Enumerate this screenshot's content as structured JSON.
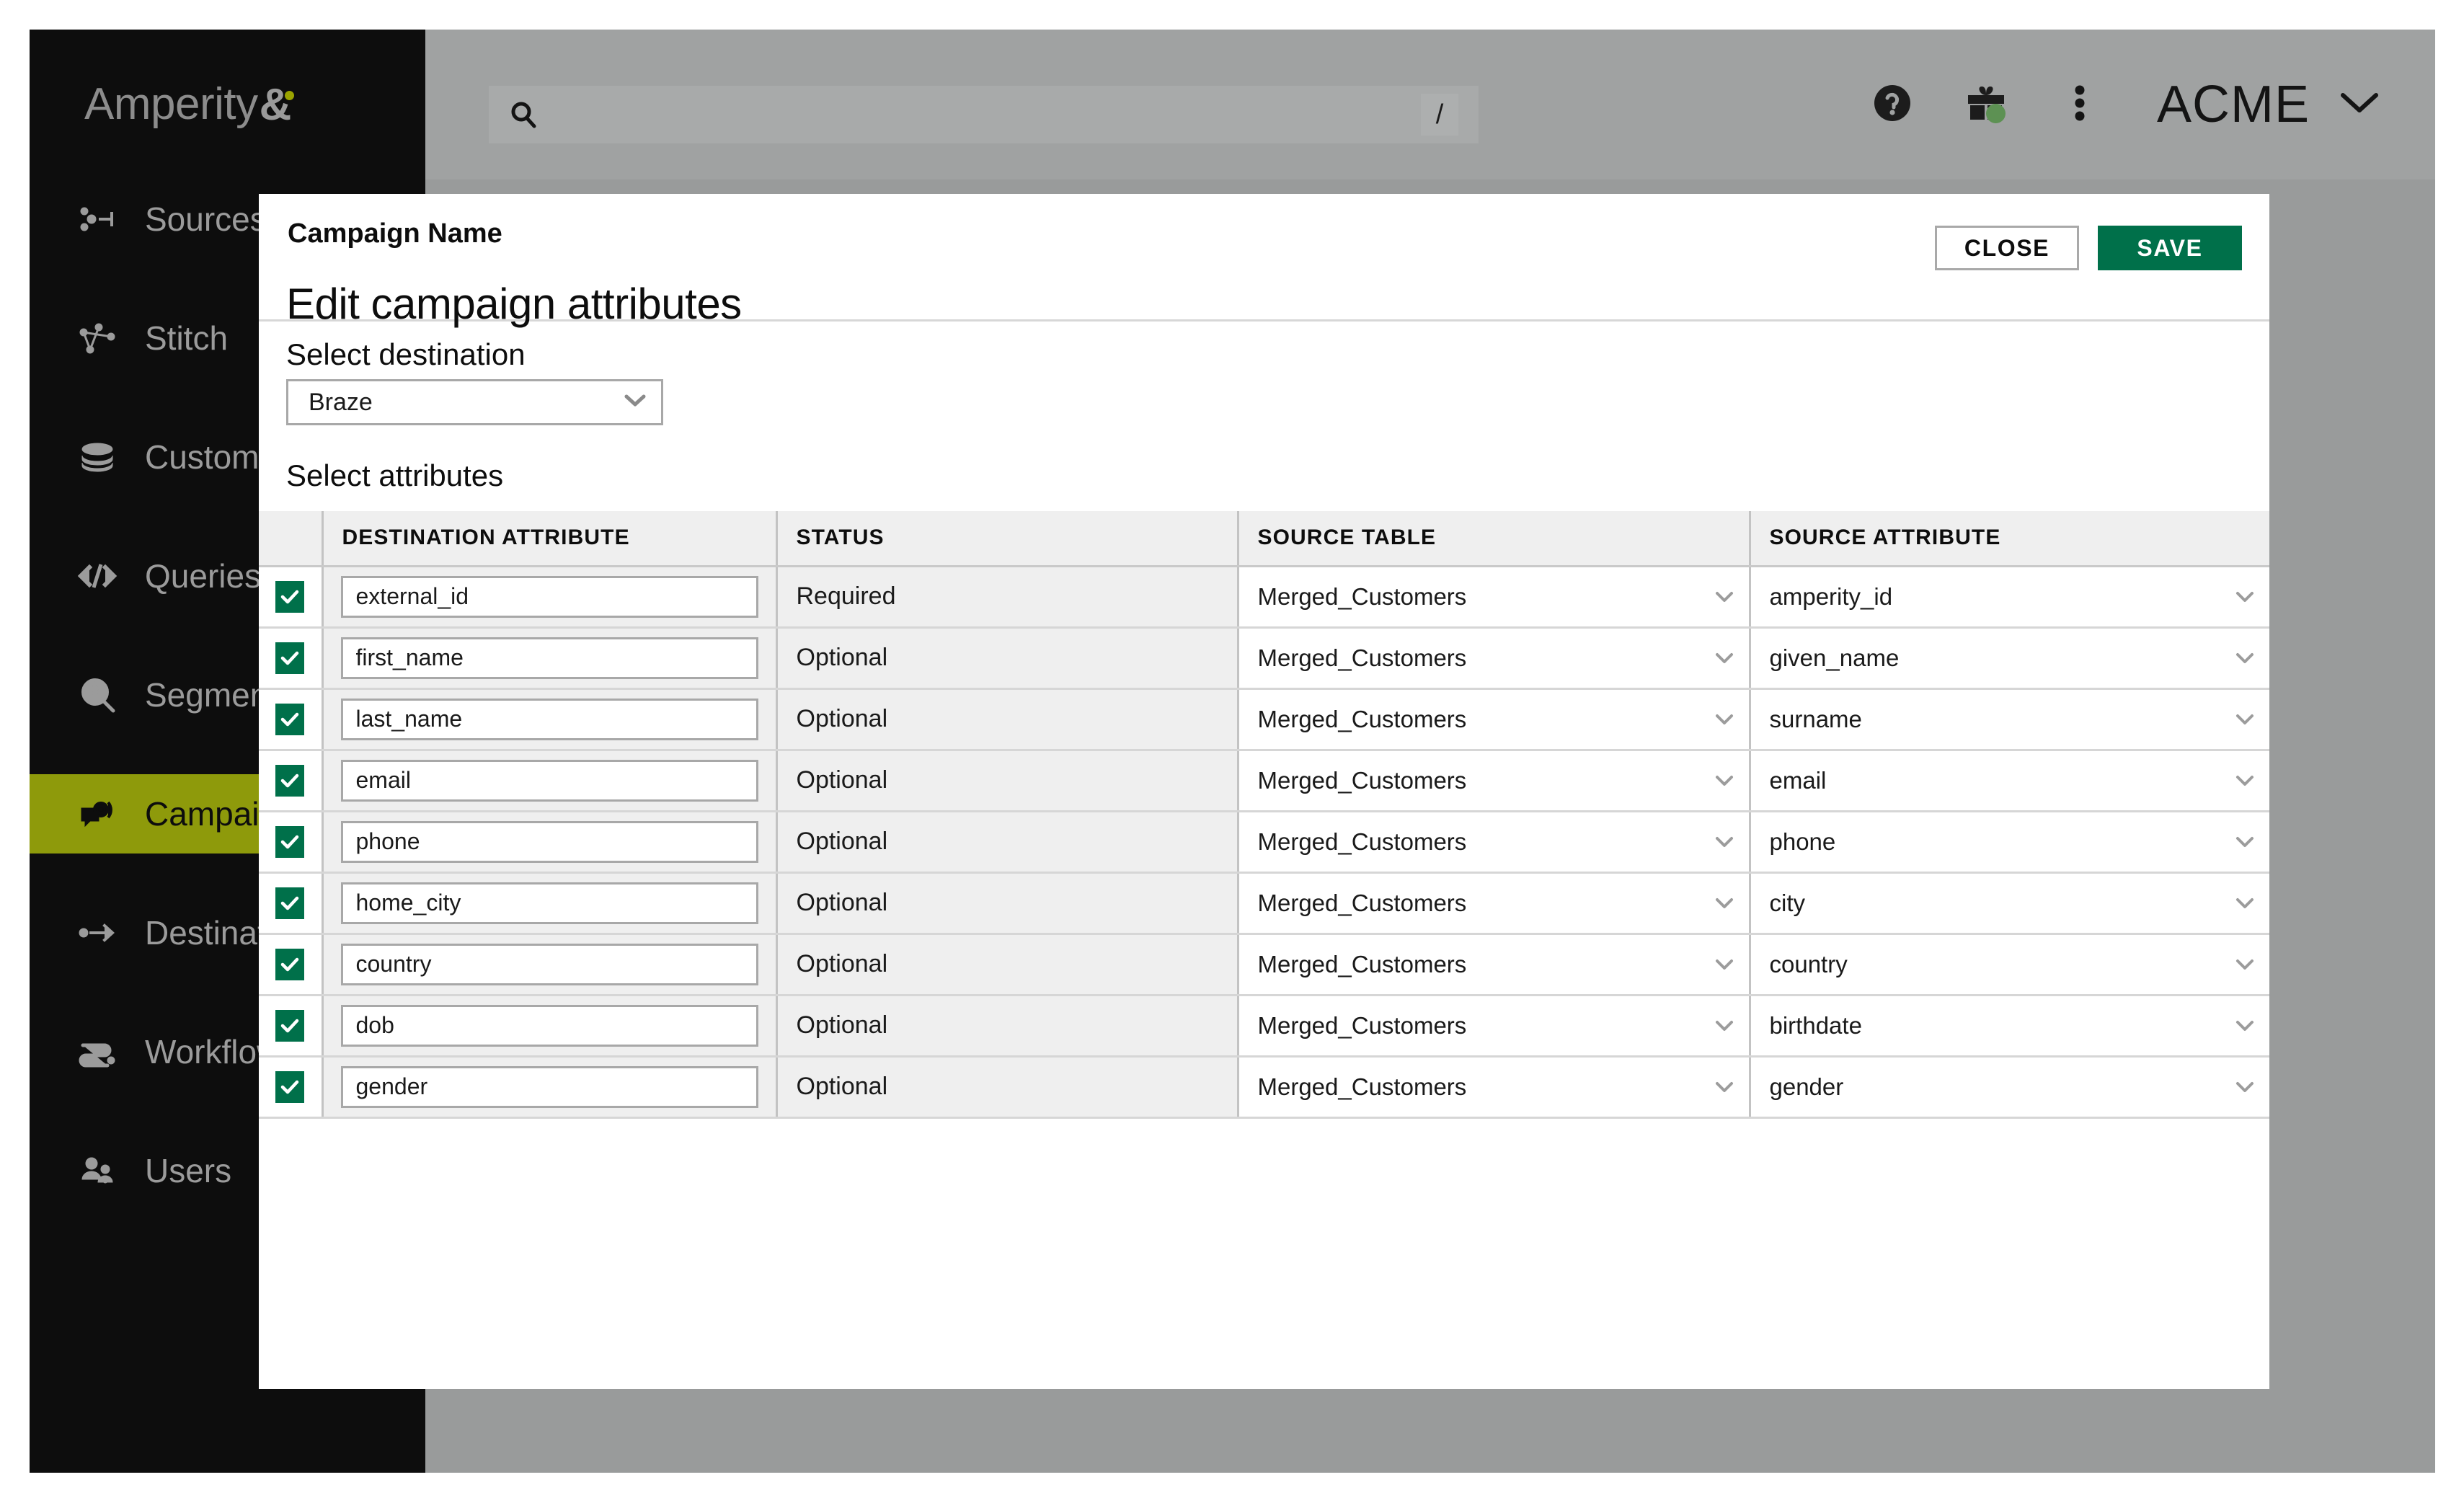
{
  "app": {
    "brand": {
      "name": "Amperity",
      "ampersand": "&"
    }
  },
  "topbar": {
    "search": {
      "placeholder": "",
      "value": "",
      "shortcut": "/",
      "icon": "search-icon"
    },
    "help_icon": "help-circle-icon",
    "gift_icon": "gift-icon",
    "gift_badge": true,
    "more_icon": "kebab-menu-icon",
    "account": {
      "name": "ACME",
      "chevron": "chevron-down-icon"
    }
  },
  "sidebar": {
    "items": [
      {
        "label": "Sources",
        "icon": "sources-icon",
        "active": false
      },
      {
        "label": "Stitch",
        "icon": "stitch-icon",
        "active": false
      },
      {
        "label": "Customers",
        "icon": "customers-icon",
        "active": false
      },
      {
        "label": "Queries",
        "icon": "queries-icon",
        "active": false
      },
      {
        "label": "Segments",
        "icon": "segments-icon",
        "active": false
      },
      {
        "label": "Campaigns",
        "icon": "campaigns-icon",
        "active": true
      },
      {
        "label": "Destinations",
        "icon": "destinations-icon",
        "active": false
      },
      {
        "label": "Workflows",
        "icon": "workflows-icon",
        "active": false
      },
      {
        "label": "Users",
        "icon": "users-icon",
        "active": false
      }
    ]
  },
  "modal": {
    "eyebrow": "Campaign Name",
    "title": "Edit campaign attributes",
    "close_label": "CLOSE",
    "save_label": "SAVE",
    "destination_label": "Select destination",
    "destination_value": "Braze",
    "attributes_label": "Select attributes",
    "table": {
      "headers": [
        "",
        "DESTINATION ATTRIBUTE",
        "STATUS",
        "SOURCE TABLE",
        "SOURCE ATTRIBUTE"
      ],
      "rows": [
        {
          "checked": true,
          "destination_attribute": "external_id",
          "status": "Required",
          "source_table": "Merged_Customers",
          "source_attribute": "amperity_id"
        },
        {
          "checked": true,
          "destination_attribute": "first_name",
          "status": "Optional",
          "source_table": "Merged_Customers",
          "source_attribute": "given_name"
        },
        {
          "checked": true,
          "destination_attribute": "last_name",
          "status": "Optional",
          "source_table": "Merged_Customers",
          "source_attribute": "surname"
        },
        {
          "checked": true,
          "destination_attribute": "email",
          "status": "Optional",
          "source_table": "Merged_Customers",
          "source_attribute": "email"
        },
        {
          "checked": true,
          "destination_attribute": "phone",
          "status": "Optional",
          "source_table": "Merged_Customers",
          "source_attribute": "phone"
        },
        {
          "checked": true,
          "destination_attribute": "home_city",
          "status": "Optional",
          "source_table": "Merged_Customers",
          "source_attribute": "city"
        },
        {
          "checked": true,
          "destination_attribute": "country",
          "status": "Optional",
          "source_table": "Merged_Customers",
          "source_attribute": "country"
        },
        {
          "checked": true,
          "destination_attribute": "dob",
          "status": "Optional",
          "source_table": "Merged_Customers",
          "source_attribute": "birthdate"
        },
        {
          "checked": true,
          "destination_attribute": "gender",
          "status": "Optional",
          "source_table": "Merged_Customers",
          "source_attribute": "gender"
        }
      ]
    }
  },
  "colors": {
    "sidebar_bg": "#0d0d0d",
    "active_nav": "#8e9a0b",
    "brand_dot": "#9aa300",
    "save_green": "#00704a",
    "checkbox_green": "#00704a",
    "badge_green": "#5d9153",
    "app_bg": "#999b9b",
    "topbar_bg": "#a0a2a2",
    "header_row": "#efefef"
  }
}
